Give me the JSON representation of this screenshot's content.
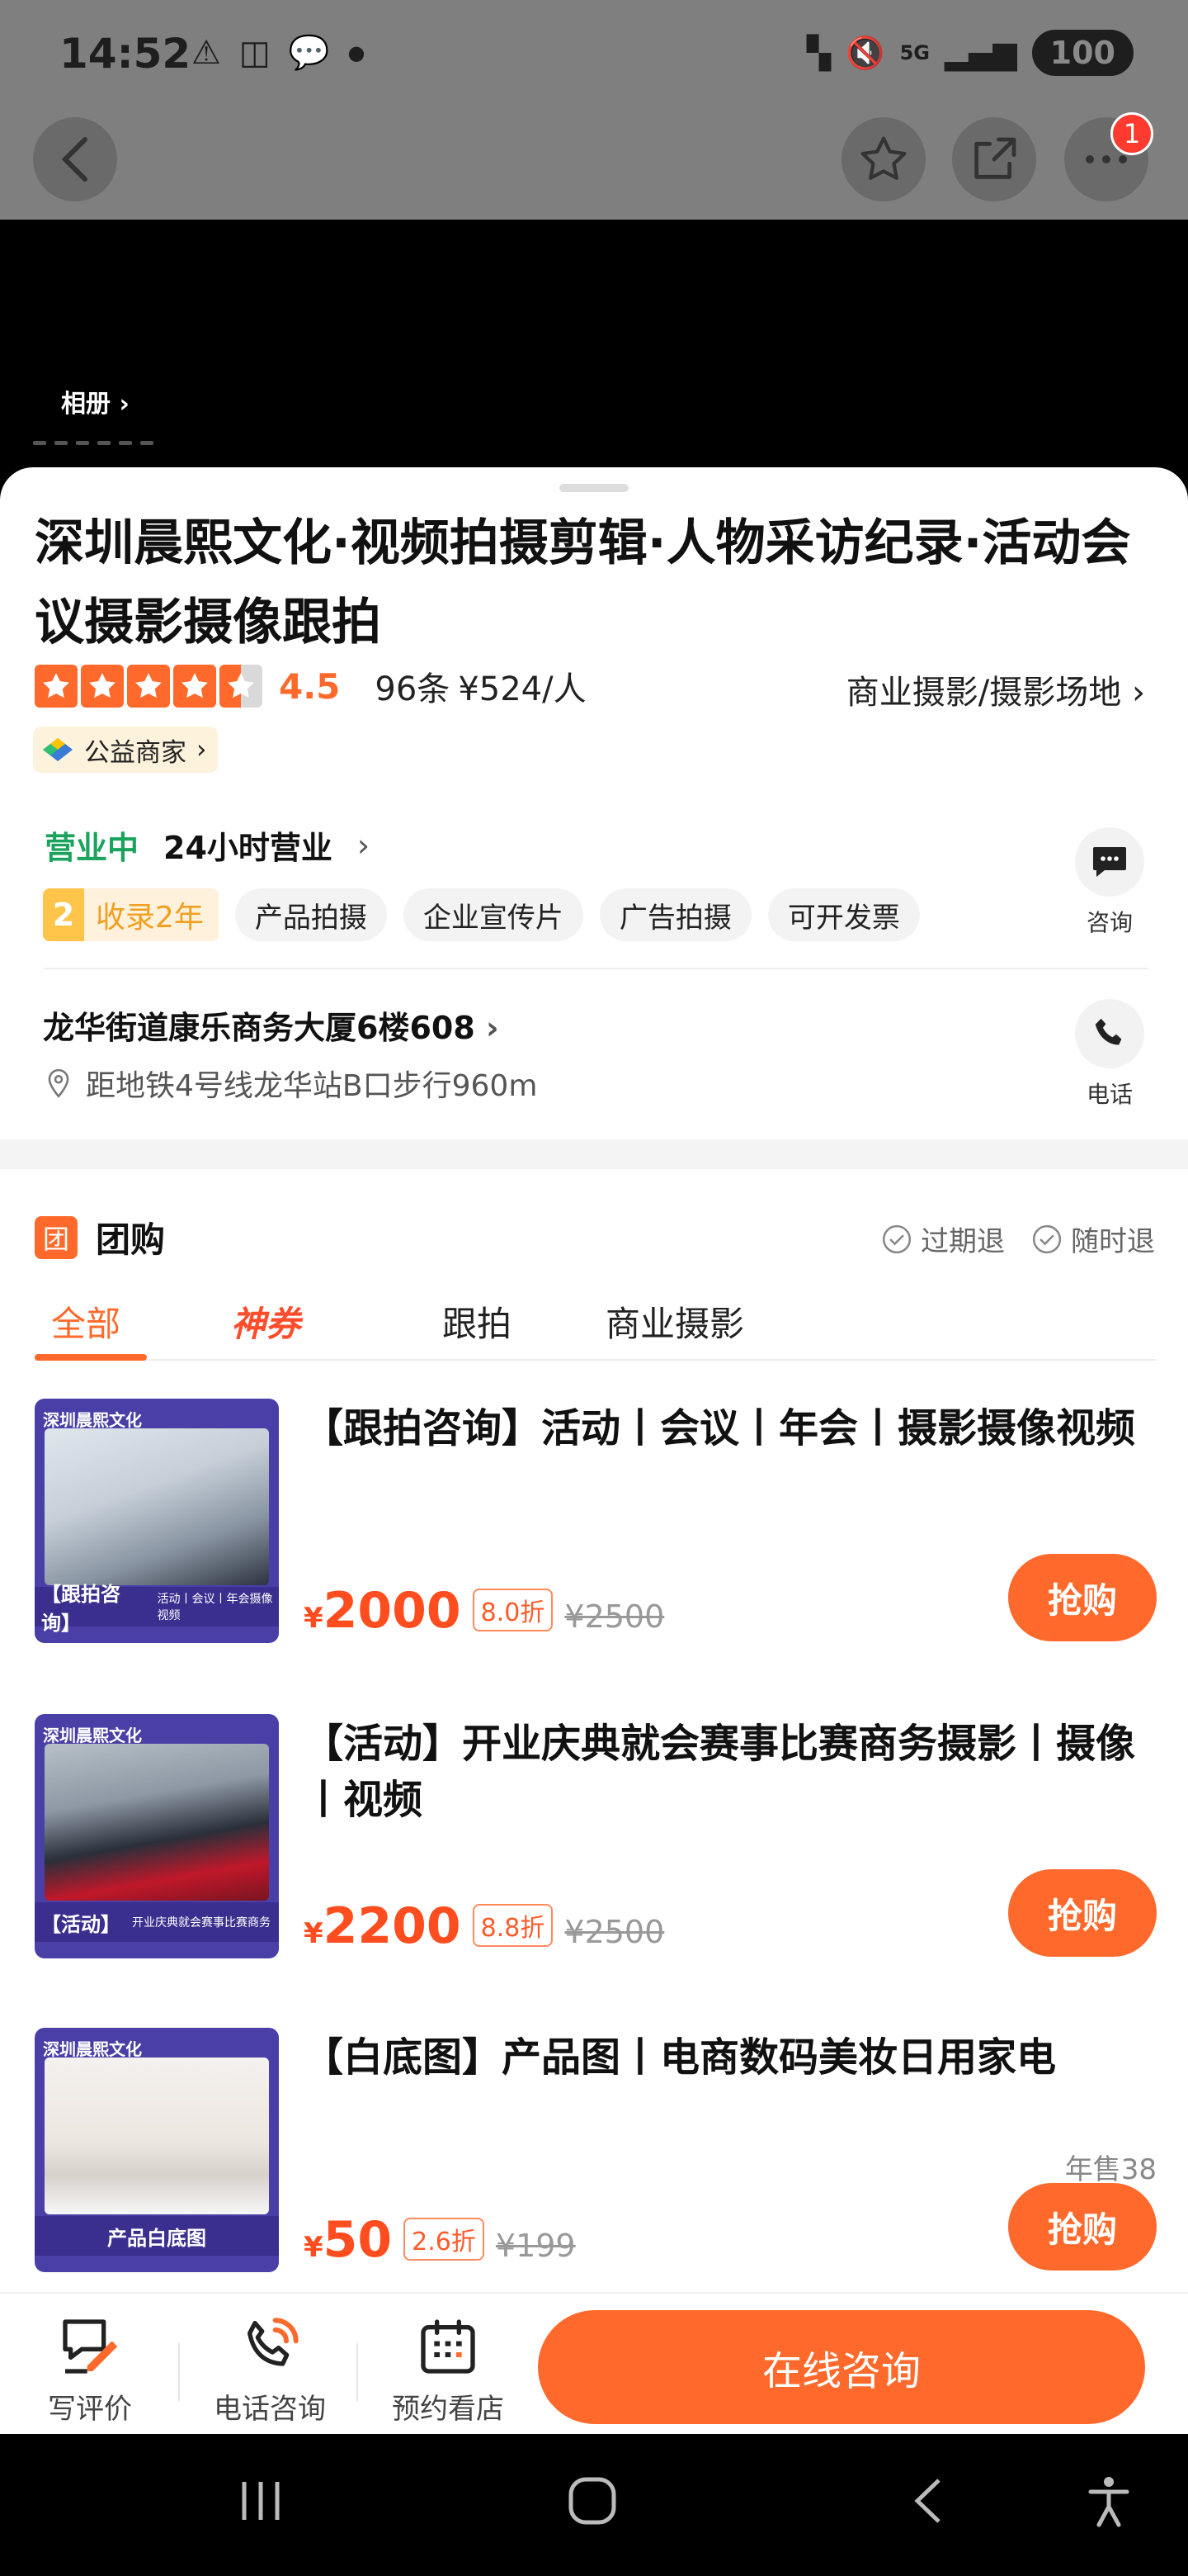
{
  "status_bar": {
    "time": "14:52",
    "network": "5G",
    "battery": "100"
  },
  "nav": {
    "more_badge": "1"
  },
  "hero": {
    "album_label": "相册"
  },
  "shop": {
    "title": "深圳晨熙文化·视频拍摄剪辑·人物采访纪录·活动会议摄影摄像跟拍",
    "rating": "4.5",
    "review_count": "96条",
    "price_per_person": "¥524/人",
    "category": "商业摄影/摄影场地",
    "charity_label": "公益商家",
    "open_status": "营业中",
    "hours": "24小时营业",
    "years_num": "2",
    "years_text": "收录2年",
    "tags": [
      "产品拍摄",
      "企业宣传片",
      "广告拍摄",
      "可开发票"
    ],
    "address": "龙华街道康乐商务大厦6楼608",
    "distance": "距地铁4号线龙华站B口步行960m",
    "consult_label": "咨询",
    "call_label": "电话"
  },
  "group_buy": {
    "section_title": "团购",
    "section_icon": "团",
    "refund_expired": "过期退",
    "refund_anytime": "随时退",
    "tabs": [
      "全部",
      "神券",
      "跟拍",
      "商业摄影"
    ],
    "deals": [
      {
        "title": "【跟拍咨询】活动丨会议丨年会丨摄影摄像视频",
        "currency": "¥",
        "price": "2000",
        "discount": "8.0折",
        "original_price": "¥2500",
        "buy_label": "抢购",
        "thumb_brand": "深圳晨熙文化",
        "thumb_tag": "【跟拍咨询】",
        "thumb_sub": "活动丨会议丨年会摄像视频"
      },
      {
        "title": "【活动】开业庆典就会赛事比赛商务摄影丨摄像丨视频",
        "currency": "¥",
        "price": "2200",
        "discount": "8.8折",
        "original_price": "¥2500",
        "buy_label": "抢购",
        "thumb_brand": "深圳晨熙文化",
        "thumb_tag": "【活动】",
        "thumb_sub": "开业庆典就会赛事比赛商务"
      },
      {
        "title": "【白底图】产品图丨电商数码美妆日用家电",
        "currency": "¥",
        "price": "50",
        "discount": "2.6折",
        "original_price": "¥199",
        "buy_label": "抢购",
        "sold": "年售38",
        "thumb_brand": "深圳晨熙文化",
        "thumb_tag": "产品白底图",
        "thumb_sub": ""
      }
    ]
  },
  "bottom_bar": {
    "review_label": "写评价",
    "phone_label": "电话咨询",
    "book_label": "预约看店",
    "consult_label": "在线咨询"
  },
  "colors": {
    "accent": "#ff6a2c",
    "price": "#ff4d1f",
    "open": "#1aa35c"
  }
}
